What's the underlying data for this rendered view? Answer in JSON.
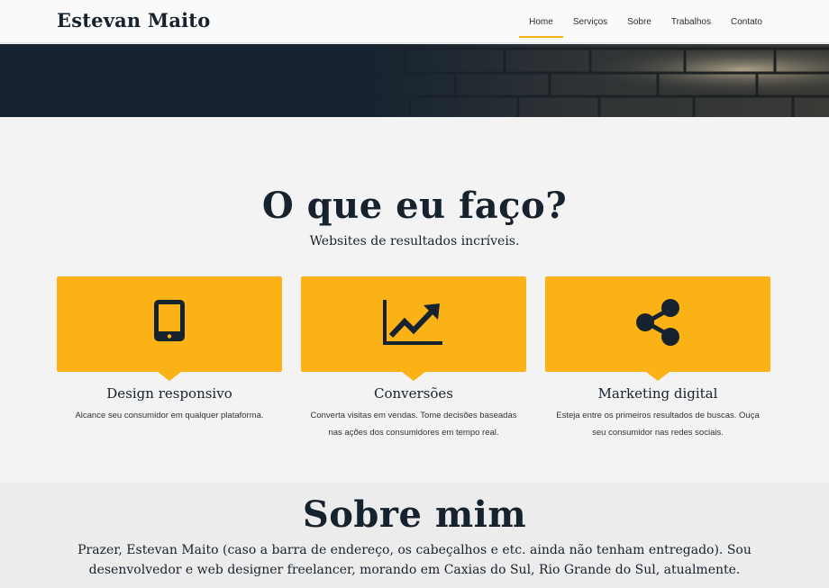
{
  "header": {
    "brand": "Estevan Maito",
    "nav": [
      "Home",
      "Serviços",
      "Sobre",
      "Trabalhos",
      "Contato"
    ],
    "active_index": 0
  },
  "colors": {
    "accent": "#fbb217",
    "navy": "#16222d",
    "page_bg": "#f3f3f3"
  },
  "services": {
    "title": "O que eu faço?",
    "subtitle": "Websites de resultados incríveis.",
    "cards": [
      {
        "icon": "tablet-icon",
        "title": "Design responsivo",
        "text": "Alcance seu consumidor em qualquer plataforma."
      },
      {
        "icon": "chart-line-icon",
        "title": "Conversões",
        "text": "Converta visitas em vendas. Tome decisões baseadas nas ações dos consumidores em tempo real."
      },
      {
        "icon": "share-icon",
        "title": "Marketing digital",
        "text": "Esteja entre os primeiros resultados de buscas. Ouça seu consumidor nas redes sociais."
      }
    ]
  },
  "about": {
    "title": "Sobre mim",
    "text": "Prazer, Estevan Maito (caso a barra de endereço, os cabeçalhos e etc. ainda não tenham entregado). Sou desenvolvedor e web designer freelancer, morando em Caxias do Sul, Rio Grande do Sul, atualmente."
  }
}
